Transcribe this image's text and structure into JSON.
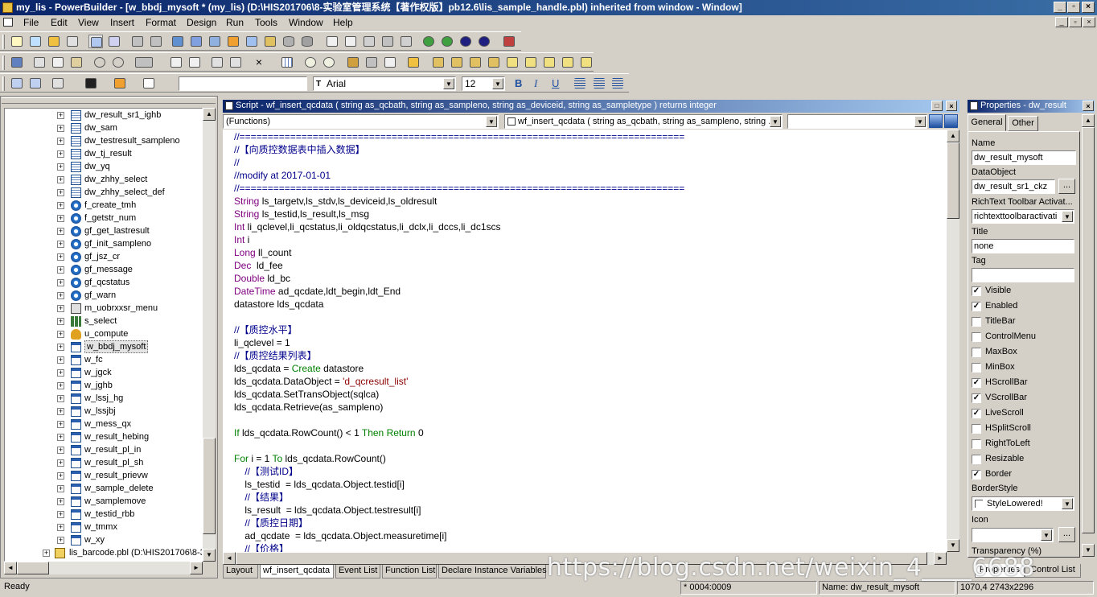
{
  "window": {
    "title": "my_lis - PowerBuilder - [w_bbdj_mysoft * (my_lis) (D:\\HIS201706\\8-实验室管理系统【著作权版】pb12.6\\lis_sample_handle.pbl) inherited from window - Window]"
  },
  "menu": [
    "File",
    "Edit",
    "View",
    "Insert",
    "Format",
    "Design",
    "Run",
    "Tools",
    "Window",
    "Help"
  ],
  "font_toolbar": {
    "style_value": "",
    "font_name": "Arial",
    "font_size": "12",
    "bold": "B",
    "italic": "I",
    "underline": "U"
  },
  "tree": {
    "items": [
      {
        "label": "dw_result_sr1_ighb",
        "icon": "datawindow-icon"
      },
      {
        "label": "dw_sam",
        "icon": "datawindow-icon"
      },
      {
        "label": "dw_testresult_sampleno",
        "icon": "datawindow-icon"
      },
      {
        "label": "dw_tj_result",
        "icon": "datawindow-icon"
      },
      {
        "label": "dw_yq",
        "icon": "datawindow-icon"
      },
      {
        "label": "dw_zhhy_select",
        "icon": "datawindow-icon"
      },
      {
        "label": "dw_zhhy_select_def",
        "icon": "datawindow-icon"
      },
      {
        "label": "f_create_tmh",
        "icon": "function-icon"
      },
      {
        "label": "f_getstr_num",
        "icon": "function-icon"
      },
      {
        "label": "gf_get_lastresult",
        "icon": "function-icon"
      },
      {
        "label": "gf_init_sampleno",
        "icon": "function-icon"
      },
      {
        "label": "gf_jsz_cr",
        "icon": "function-icon"
      },
      {
        "label": "gf_message",
        "icon": "function-icon"
      },
      {
        "label": "gf_qcstatus",
        "icon": "function-icon"
      },
      {
        "label": "gf_warn",
        "icon": "function-icon"
      },
      {
        "label": "m_uobrxxsr_menu",
        "icon": "menu-icon"
      },
      {
        "label": "s_select",
        "icon": "structure-icon"
      },
      {
        "label": "u_compute",
        "icon": "userobject-icon"
      },
      {
        "label": "w_bbdj_mysoft",
        "icon": "window-icon",
        "selected": true
      },
      {
        "label": "w_fc",
        "icon": "window-icon"
      },
      {
        "label": "w_jgck",
        "icon": "window-icon"
      },
      {
        "label": "w_jghb",
        "icon": "window-icon"
      },
      {
        "label": "w_lssj_hg",
        "icon": "window-icon"
      },
      {
        "label": "w_lssjbj",
        "icon": "window-icon"
      },
      {
        "label": "w_mess_qx",
        "icon": "window-icon"
      },
      {
        "label": "w_result_hebing",
        "icon": "window-icon"
      },
      {
        "label": "w_result_pl_in",
        "icon": "window-icon"
      },
      {
        "label": "w_result_pl_sh",
        "icon": "window-icon"
      },
      {
        "label": "w_result_prievw",
        "icon": "window-icon"
      },
      {
        "label": "w_sample_delete",
        "icon": "window-icon"
      },
      {
        "label": "w_samplemove",
        "icon": "window-icon"
      },
      {
        "label": "w_testid_rbb",
        "icon": "window-icon"
      },
      {
        "label": "w_tmmx",
        "icon": "window-icon"
      },
      {
        "label": "w_xy",
        "icon": "window-icon"
      }
    ],
    "library": "lis_barcode.pbl (D:\\HIS201706\\8-3"
  },
  "script": {
    "title": "Script - wf_insert_qcdata ( string as_qcbath, string as_sampleno, string as_deviceid, string as_sampletype )  returns integer",
    "object_dropdown": "(Functions)",
    "event_dropdown": "wf_insert_qcdata ( string as_qcbath, string as_sampleno, string ...",
    "tabs": [
      "Layout",
      "wf_insert_qcdata",
      "Event List",
      "Function List",
      "Declare Instance Variables"
    ],
    "lines": [
      [
        {
          "c": "cm",
          "t": "//==============================================================================="
        }
      ],
      [
        {
          "c": "cm",
          "t": "//【向质控数据表中插入数据】"
        }
      ],
      [
        {
          "c": "cm",
          "t": "//"
        }
      ],
      [
        {
          "c": "cm",
          "t": "//modify at 2017-01-01"
        }
      ],
      [
        {
          "c": "cm",
          "t": "//==============================================================================="
        }
      ],
      [
        {
          "c": "kw",
          "t": "String"
        },
        {
          "c": "",
          "t": " ls_targetv,ls_stdv,ls_deviceid,ls_oldresult"
        }
      ],
      [
        {
          "c": "kw",
          "t": "String"
        },
        {
          "c": "",
          "t": " ls_testid,ls_result,ls_msg"
        }
      ],
      [
        {
          "c": "kw",
          "t": "Int"
        },
        {
          "c": "",
          "t": " li_qclevel,li_qcstatus,li_oldqcstatus,li_dclx,li_dccs,li_dc1scs"
        }
      ],
      [
        {
          "c": "kw",
          "t": "Int"
        },
        {
          "c": "",
          "t": " i"
        }
      ],
      [
        {
          "c": "kw",
          "t": "Long"
        },
        {
          "c": "",
          "t": " ll_count"
        }
      ],
      [
        {
          "c": "kw",
          "t": "Dec"
        },
        {
          "c": "",
          "t": "  ld_fee"
        }
      ],
      [
        {
          "c": "kw",
          "t": "Double"
        },
        {
          "c": "",
          "t": " ld_bc"
        }
      ],
      [
        {
          "c": "kw",
          "t": "DateTime"
        },
        {
          "c": "",
          "t": " ad_qcdate,ldt_begin,ldt_End"
        }
      ],
      [
        {
          "c": "",
          "t": "datastore lds_qcdata"
        }
      ],
      [],
      [
        {
          "c": "cm",
          "t": "//【质控水平】"
        }
      ],
      [
        {
          "c": "",
          "t": "li_qclevel = 1"
        }
      ],
      [
        {
          "c": "cm",
          "t": "//【质控结果列表】"
        }
      ],
      [
        {
          "c": "",
          "t": "lds_qcdata = "
        },
        {
          "c": "fl",
          "t": "Create"
        },
        {
          "c": "",
          "t": " datastore"
        }
      ],
      [
        {
          "c": "",
          "t": "lds_qcdata.DataObject = "
        },
        {
          "c": "st",
          "t": "'d_qcresult_list'"
        }
      ],
      [
        {
          "c": "",
          "t": "lds_qcdata.SetTransObject(sqlca)"
        }
      ],
      [
        {
          "c": "",
          "t": "lds_qcdata.Retrieve(as_sampleno)"
        }
      ],
      [],
      [
        {
          "c": "fl",
          "t": "If"
        },
        {
          "c": "",
          "t": " lds_qcdata.RowCount() < 1 "
        },
        {
          "c": "fl",
          "t": "Then"
        },
        {
          "c": "",
          "t": " "
        },
        {
          "c": "fl",
          "t": "Return"
        },
        {
          "c": "",
          "t": " 0"
        }
      ],
      [],
      [
        {
          "c": "fl",
          "t": "For"
        },
        {
          "c": "",
          "t": " i = 1 "
        },
        {
          "c": "fl",
          "t": "To"
        },
        {
          "c": "",
          "t": " lds_qcdata.RowCount()"
        }
      ],
      [
        {
          "c": "",
          "t": "    "
        },
        {
          "c": "cm",
          "t": "//【测试ID】"
        }
      ],
      [
        {
          "c": "",
          "t": "    ls_testid  = lds_qcdata.Object.testid[i]"
        }
      ],
      [
        {
          "c": "",
          "t": "    "
        },
        {
          "c": "cm",
          "t": "//【结果】"
        }
      ],
      [
        {
          "c": "",
          "t": "    ls_result  = lds_qcdata.Object.testresult[i]"
        }
      ],
      [
        {
          "c": "",
          "t": "    "
        },
        {
          "c": "cm",
          "t": "//【质控日期】"
        }
      ],
      [
        {
          "c": "",
          "t": "    ad_qcdate  = lds_qcdata.Object.measuretime[i]"
        }
      ],
      [
        {
          "c": "",
          "t": "    "
        },
        {
          "c": "cm",
          "t": "//【价格】"
        }
      ]
    ]
  },
  "properties": {
    "title": "Properties - dw_result",
    "tabs": [
      "General",
      "Other"
    ],
    "name_label": "Name",
    "name_value": "dw_result_mysoft",
    "dataobject_label": "DataObject",
    "dataobject_value": "dw_result_sr1_ckz",
    "richtext_label": "RichText Toolbar Activat...",
    "richtext_value": "richtexttoolbaractivati",
    "title_label": "Title",
    "title_value": "none",
    "tag_label": "Tag",
    "tag_value": "",
    "checks": [
      {
        "label": "Visible",
        "checked": true
      },
      {
        "label": "Enabled",
        "checked": true
      },
      {
        "label": "TitleBar",
        "checked": false
      },
      {
        "label": "ControlMenu",
        "checked": false
      },
      {
        "label": "MaxBox",
        "checked": false
      },
      {
        "label": "MinBox",
        "checked": false
      },
      {
        "label": "HScrollBar",
        "checked": true
      },
      {
        "label": "VScrollBar",
        "checked": true
      },
      {
        "label": "LiveScroll",
        "checked": true
      },
      {
        "label": "HSplitScroll",
        "checked": false
      },
      {
        "label": "RightToLeft",
        "checked": false
      },
      {
        "label": "Resizable",
        "checked": false
      },
      {
        "label": "Border",
        "checked": true
      }
    ],
    "borderstyle_label": "BorderStyle",
    "borderstyle_value": "StyleLowered!",
    "icon_label": "Icon",
    "icon_value": "",
    "transparency_label": "Transparency (%)",
    "bottom_tabs": [
      "Properties",
      "Control List"
    ],
    "ellipsis": "..."
  },
  "status": {
    "text": "Ready",
    "position": "* 0004:0009",
    "name": "Name: dw_result_mysoft",
    "coords": "1070,4 2743x2296"
  },
  "watermark": "https://blog.csdn.net/weixin_4____6688"
}
